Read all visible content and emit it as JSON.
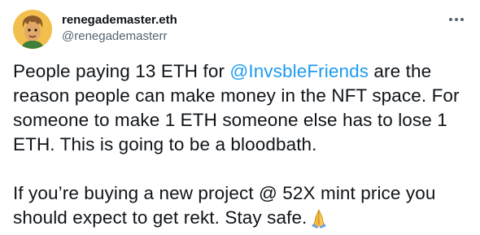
{
  "author": {
    "display_name": "renegademaster.eth",
    "handle": "@renegademasterr"
  },
  "tweet": {
    "para1": {
      "text_before": "People paying 13 ETH for ",
      "mention": "@InvsbleFriends",
      "text_after": " are the reason people can make money in the NFT space. For someone to make 1 ETH someone else has to lose 1 ETH. This is going to be a bloodbath."
    },
    "para2": {
      "text": "If you’re buying a new project @ 52X mint price you should expect to get rekt. Stay safe.",
      "emoji": "folded-hands-icon"
    }
  },
  "icons": {
    "more": "more-horizontal-icon",
    "avatar": "avatar-image"
  },
  "colors": {
    "text": "#0f1419",
    "secondary": "#536471",
    "link": "#1d9bf0",
    "background": "#ffffff"
  }
}
